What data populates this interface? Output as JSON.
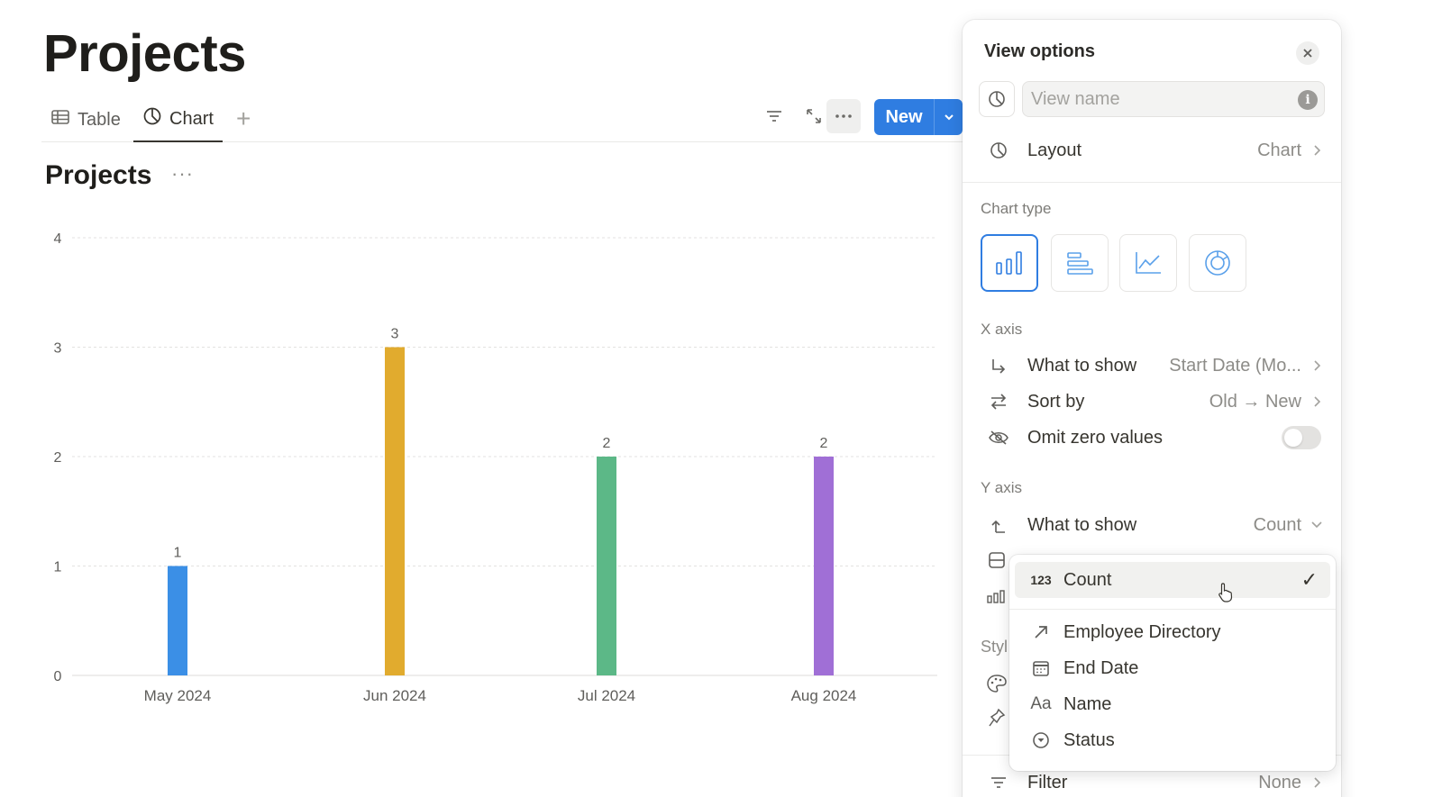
{
  "page": {
    "title": "Projects"
  },
  "tabs": [
    {
      "label": "Table",
      "icon": "table-icon"
    },
    {
      "label": "Chart",
      "icon": "chart-icon"
    }
  ],
  "toolbar": {
    "new_label": "New"
  },
  "chart_header": {
    "title": "Projects",
    "more": "···"
  },
  "chart_data": {
    "type": "bar",
    "categories": [
      "May 2024",
      "Jun 2024",
      "Jul 2024",
      "Aug 2024"
    ],
    "values": [
      1,
      3,
      2,
      2
    ],
    "colors": [
      "#3b8fe6",
      "#e1ab2e",
      "#5cb887",
      "#a06fd6"
    ],
    "ylim": [
      0,
      4
    ],
    "yticks": [
      0,
      1,
      2,
      3,
      4
    ],
    "data_labels": true,
    "grid": true,
    "title": "",
    "xlabel": "",
    "ylabel": ""
  },
  "panel": {
    "title": "View options",
    "view_name_placeholder": "View name",
    "layout": {
      "label": "Layout",
      "value": "Chart"
    },
    "chart_type_label": "Chart type",
    "x_axis": {
      "label": "X axis",
      "what": {
        "label": "What to show",
        "value": "Start Date (Mo..."
      },
      "sort": {
        "label": "Sort by",
        "value": "Old → New"
      },
      "omit": {
        "label": "Omit zero values"
      }
    },
    "y_axis": {
      "label": "Y axis",
      "what": {
        "label": "What to show",
        "value": "Count"
      }
    },
    "style_partial": "Styl",
    "filter": {
      "label": "Filter",
      "value": "None"
    }
  },
  "dropdown": {
    "selected": {
      "label": "Count",
      "icon_text": "123"
    },
    "items": [
      {
        "label": "Employee Directory",
        "icon": "relation-arrow-icon"
      },
      {
        "label": "End Date",
        "icon": "calendar-icon"
      },
      {
        "label": "Name",
        "icon_text": "Aa",
        "icon": "text-property-icon"
      },
      {
        "label": "Status",
        "icon": "status-icon"
      }
    ]
  }
}
